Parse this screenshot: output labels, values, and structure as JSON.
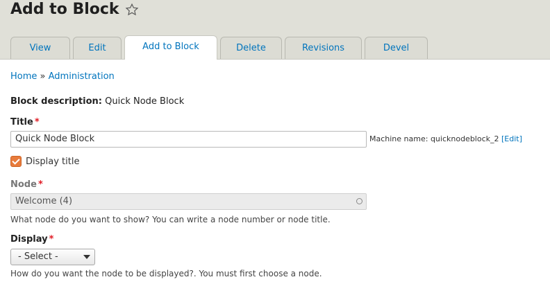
{
  "header": {
    "title": "Add to Block"
  },
  "tabs": [
    {
      "label": "View"
    },
    {
      "label": "Edit"
    },
    {
      "label": "Add to Block"
    },
    {
      "label": "Delete"
    },
    {
      "label": "Revisions"
    },
    {
      "label": "Devel"
    }
  ],
  "breadcrumb": {
    "home": "Home",
    "separator": "»",
    "admin": "Administration"
  },
  "block_description": {
    "label": "Block description:",
    "value": "Quick Node Block"
  },
  "title_field": {
    "label": "Title",
    "required": "*",
    "value": "Quick Node Block",
    "machine_prefix": "Machine name: quicknodeblock_2",
    "machine_edit": "[Edit]"
  },
  "display_title": {
    "label": "Display title"
  },
  "node_field": {
    "label": "Node",
    "required": "*",
    "value": "Welcome (4)",
    "help": "What node do you want to show? You can write a node number or node title."
  },
  "display_field": {
    "label": "Display",
    "required": "*",
    "selected": "- Select -",
    "help": "How do you want the node to be displayed?. You must first choose a node."
  },
  "colors": {
    "link": "#0074bd",
    "required": "#e01b24",
    "checkbox": "#e87b3c"
  }
}
